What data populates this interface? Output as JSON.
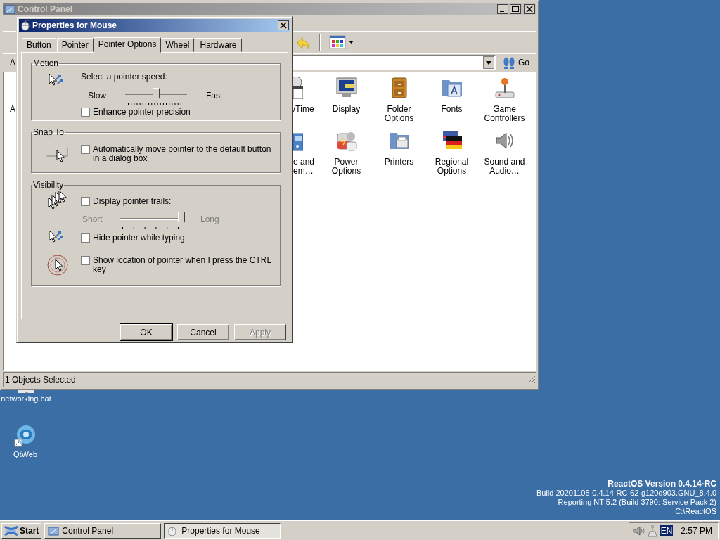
{
  "desktop": {
    "icons": [
      {
        "label": "networking.bat"
      },
      {
        "label": "QtWeb"
      }
    ],
    "version_info": [
      "ReactOS Version 0.4.14-RC",
      "Build 20201105-0.4.14-RC-62-g120d903.GNU_8.4.0",
      "Reporting NT 5.2 (Build 3790: Service Pack 2)",
      "C:\\ReactOS"
    ]
  },
  "control_panel": {
    "title": "Control Panel",
    "active": false,
    "address_label": "A",
    "go_button": "Go",
    "items": [
      {
        "label": "A"
      },
      {
        "label": "/Time"
      },
      {
        "label": "Display"
      },
      {
        "label": "Folder Options"
      },
      {
        "label": "Fonts"
      },
      {
        "label": "Game Controllers"
      },
      {
        "label": "e and em…"
      },
      {
        "label": "Power Options"
      },
      {
        "label": "Printers"
      },
      {
        "label": "Regional Options"
      },
      {
        "label": "Sound and Audio…"
      }
    ],
    "status_bar": "1 Objects Selected"
  },
  "dialog": {
    "title": "Properties for Mouse",
    "active": true,
    "tabs": [
      {
        "label": "Button",
        "selected": false
      },
      {
        "label": "Pointer",
        "selected": false
      },
      {
        "label": "Pointer Options",
        "selected": true
      },
      {
        "label": "Wheel",
        "selected": false
      },
      {
        "label": "Hardware",
        "selected": false
      }
    ],
    "groups": [
      {
        "title": "Motion",
        "rows": [
          {
            "kind": "label",
            "text": "Select a pointer speed:"
          },
          {
            "kind": "slider",
            "min_label": "Slow",
            "max_label": "Fast",
            "level": 0.5,
            "disabled": false
          },
          {
            "kind": "checkbox",
            "label": "Enhance pointer precision",
            "checked": false
          }
        ]
      },
      {
        "title": "Snap To",
        "rows": [
          {
            "kind": "checkbox",
            "label": "Automatically move pointer to the default button in a dialog box",
            "checked": false
          }
        ]
      },
      {
        "title": "Visibility",
        "rows": [
          {
            "kind": "checkbox",
            "label": "Display pointer trails:",
            "checked": false
          },
          {
            "kind": "slider",
            "min_label": "Short",
            "max_label": "Long",
            "level": 1.0,
            "disabled": true
          },
          {
            "kind": "checkbox",
            "label": "Hide pointer while typing",
            "checked": false
          },
          {
            "kind": "checkbox",
            "label": "Show location of pointer when I press the CTRL key",
            "checked": false
          }
        ]
      }
    ],
    "buttons": [
      {
        "label": "OK",
        "default": true,
        "disabled": false
      },
      {
        "label": "Cancel",
        "default": false,
        "disabled": false
      },
      {
        "label": "Apply",
        "default": false,
        "disabled": true
      }
    ]
  },
  "taskbar": {
    "start": "Start",
    "tasks": [
      {
        "label": "Control Panel",
        "selected": false
      },
      {
        "label": "Properties for Mouse",
        "selected": true
      }
    ],
    "language": "EN",
    "time": "2:57 PM"
  }
}
